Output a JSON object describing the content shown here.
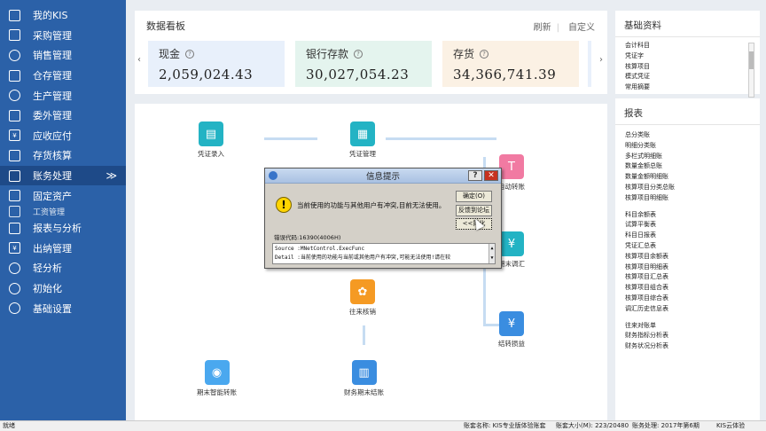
{
  "sidebar": {
    "items": [
      {
        "label": "我的KIS",
        "icon": "monitor-icon"
      },
      {
        "label": "采购管理",
        "icon": "cart-icon"
      },
      {
        "label": "销售管理",
        "icon": "person-icon"
      },
      {
        "label": "仓存管理",
        "icon": "warehouse-icon"
      },
      {
        "label": "生产管理",
        "icon": "gear-icon"
      },
      {
        "label": "委外管理",
        "icon": "grid-icon"
      },
      {
        "label": "应收应付",
        "icon": "yen-doc-icon"
      },
      {
        "label": "存货核算",
        "icon": "box-icon"
      },
      {
        "label": "账务处理",
        "icon": "ledger-icon",
        "active": true
      },
      {
        "label": "固定资产",
        "icon": "building-icon"
      },
      {
        "label": "工资管理",
        "icon": "wallet-icon"
      },
      {
        "label": "报表与分析",
        "icon": "chart-icon"
      },
      {
        "label": "出纳管理",
        "icon": "cash-icon"
      },
      {
        "label": "轻分析",
        "icon": "search-chart-icon"
      },
      {
        "label": "初始化",
        "icon": "target-icon"
      },
      {
        "label": "基础设置",
        "icon": "settings-icon"
      }
    ],
    "active_arrow": "≫"
  },
  "dashboard": {
    "title": "数据看板",
    "refresh": "刷新",
    "customize": "自定义",
    "left_arrow": "‹",
    "right_arrow": "›",
    "cards": [
      {
        "label": "现金",
        "value": "2,059,024.43"
      },
      {
        "label": "银行存款",
        "value": "30,027,054.23"
      },
      {
        "label": "存货",
        "value": "34,366,741.39"
      }
    ]
  },
  "flow": {
    "nodes": {
      "voucher_entry": "凭证录入",
      "voucher_manage": "凭证管理",
      "auto_transfer": "自动转账",
      "period_adjust": "期末调汇",
      "contact_verify": "往来核销",
      "close_profit_loss": "结转损益",
      "smart_transfer": "期末智能转账",
      "financial_close": "财务期末结账"
    }
  },
  "basic_info": {
    "title": "基础资料",
    "items": [
      "会计科目",
      "凭证字",
      "核算项目",
      "模式凭证",
      "常用摘要"
    ]
  },
  "reports": {
    "title": "报表",
    "group1": [
      "总分类账",
      "明细分类账",
      "多栏式明细账",
      "数量金额总账",
      "数量金额明细账",
      "核算项目分类总账",
      "核算项目明细账"
    ],
    "group2": [
      "科目余额表",
      "试算平衡表",
      "科目日报表",
      "凭证汇总表",
      "核算项目余额表",
      "核算项目明细表",
      "核算项目汇总表",
      "核算项目组合表",
      "核算项目综合表",
      "调汇历史信息表"
    ],
    "group3": [
      "往来对账单",
      "财务指标分析表",
      "财务状况分析表"
    ]
  },
  "dialog": {
    "title": "信息提示",
    "help": "?",
    "close": "✕",
    "warn_glyph": "!",
    "message": "当前使用的功能与其他用户有冲突,目前无法使用。",
    "ok": "确定(O)",
    "feedback": "反馈到论坛",
    "less": "<<简化",
    "error_code": "错误代码:16390(4006H)",
    "source": "Source  :MNetControl.ExecFunc",
    "detail": "Detail  :当前使用的功能与当前或其他用户有冲突,可能无法使用!请在较",
    "scroll_up": "▲",
    "scroll_down": "▼"
  },
  "statusbar": {
    "left": "就绪",
    "book": "账套名称: KIS专业版体验账套",
    "size": "账套大小(M): 223/20480",
    "period": "账务处理: 2017年第6期",
    "cloud": "KIS云体验"
  }
}
